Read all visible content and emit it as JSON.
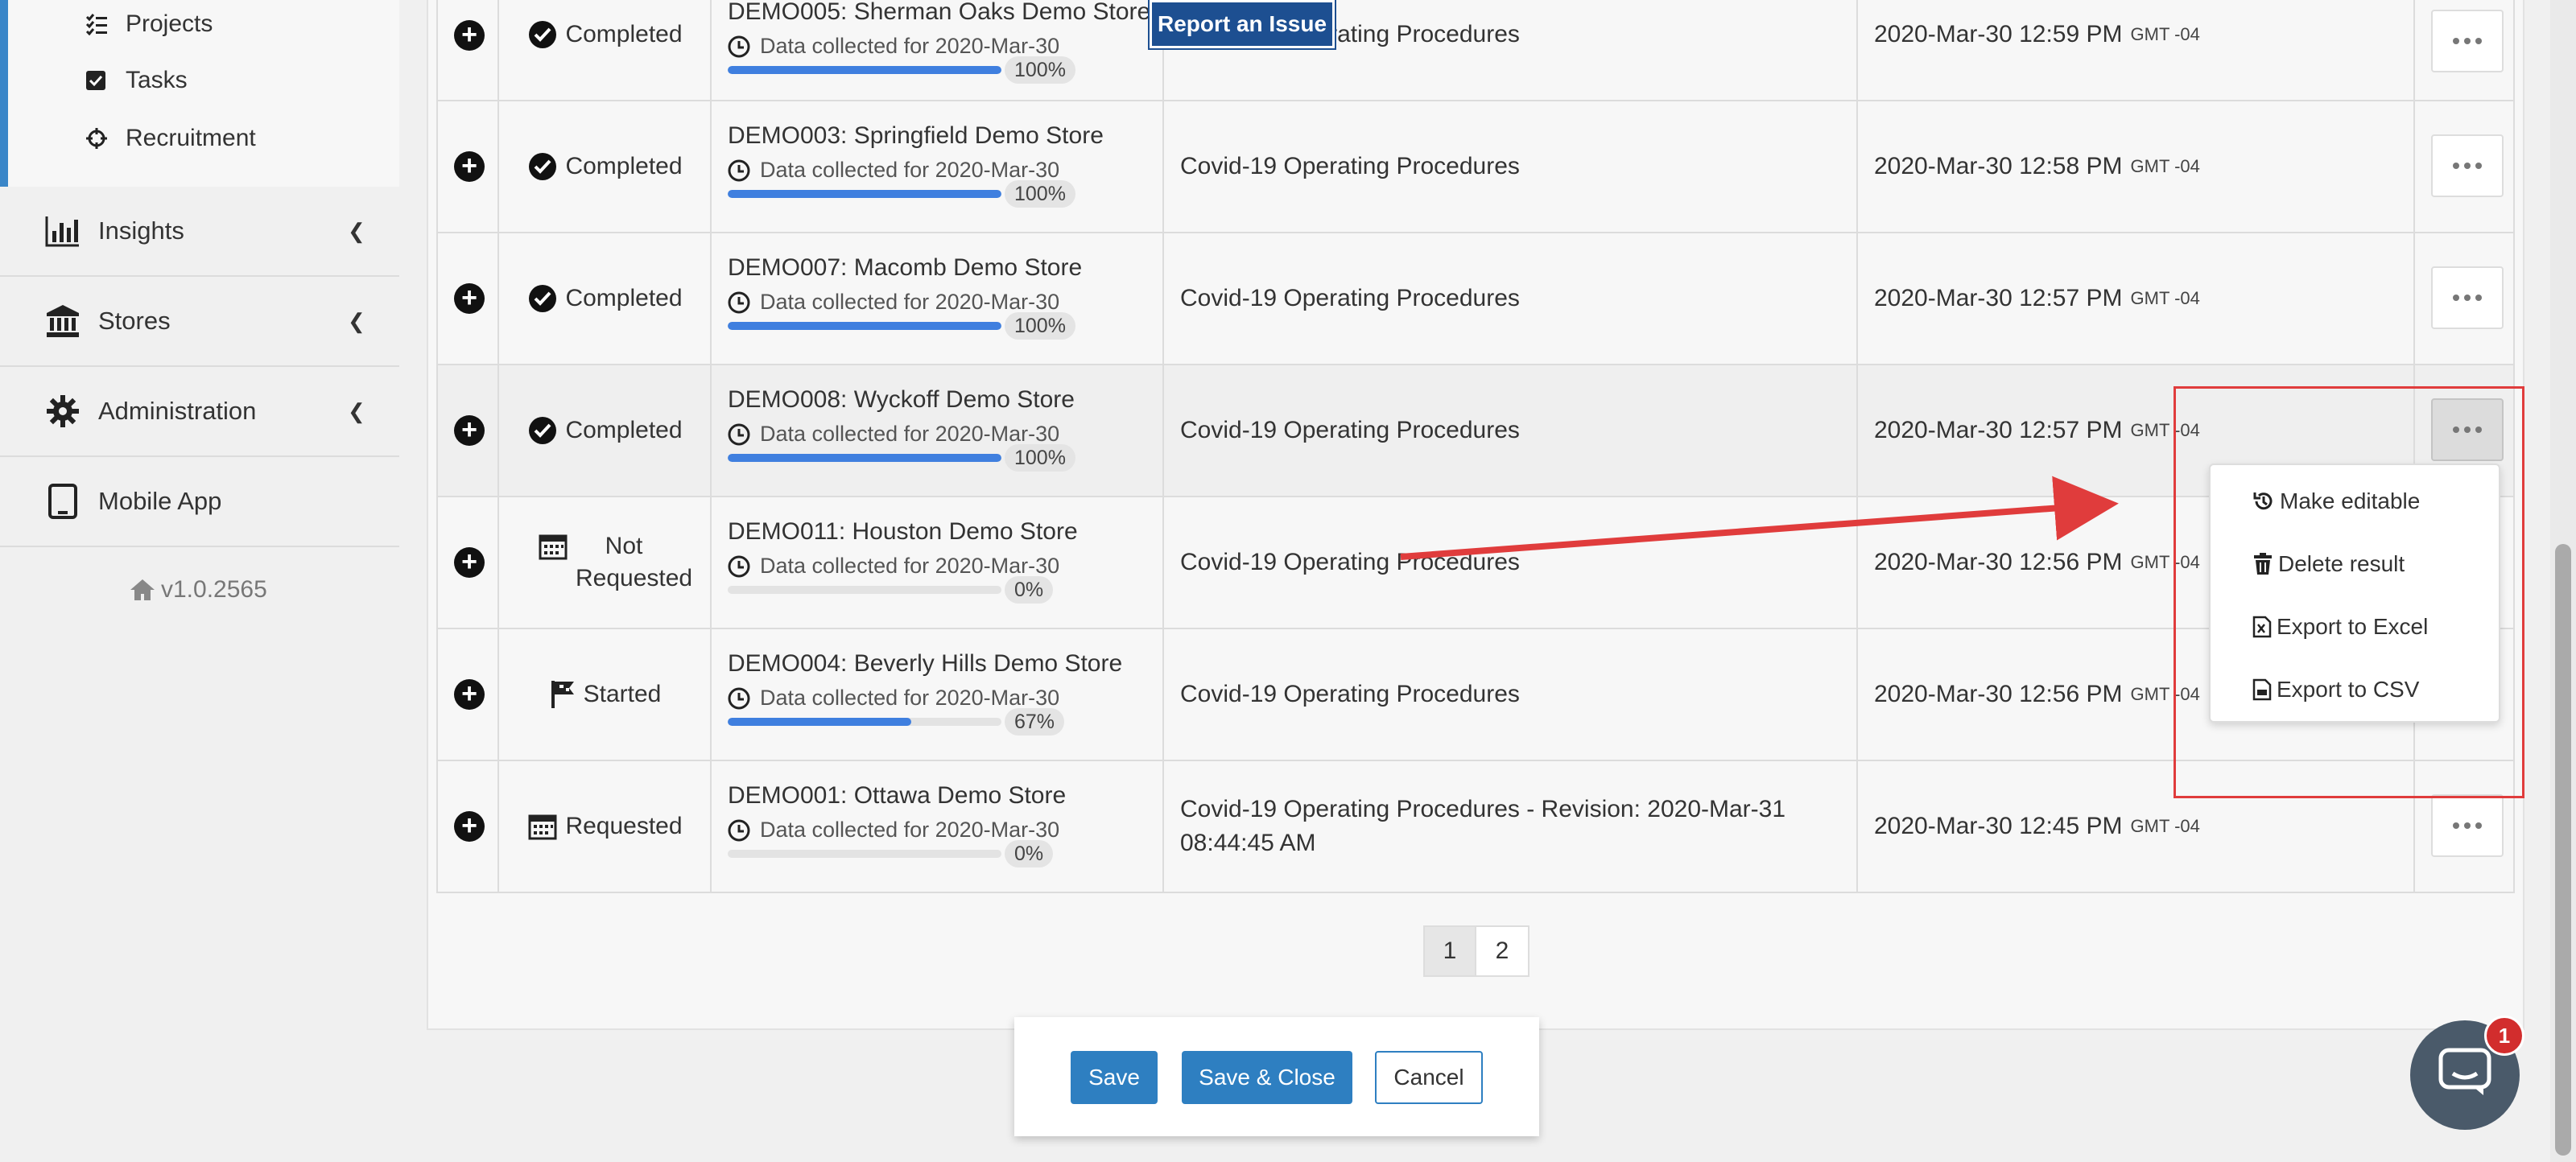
{
  "sidebar": {
    "sub_items": [
      {
        "label": "Projects",
        "icon": "list-check-icon"
      },
      {
        "label": "Tasks",
        "icon": "checkbox-icon"
      },
      {
        "label": "Recruitment",
        "icon": "crosshair-icon"
      }
    ],
    "nav_items": [
      {
        "label": "Insights",
        "icon": "bar-chart-icon"
      },
      {
        "label": "Stores",
        "icon": "bank-icon"
      },
      {
        "label": "Administration",
        "icon": "gear-icon"
      },
      {
        "label": "Mobile App",
        "icon": "tablet-icon"
      }
    ],
    "version": "v1.0.2565"
  },
  "report_issue_label": "Report an Issue",
  "rows": [
    {
      "status": "Completed",
      "store": "DEMO005: Sherman Oaks Demo Store",
      "collected": "Data collected for 2020-Mar-30",
      "progress": 100,
      "progress_label": "100%",
      "procedure": "Covid-19 Operating Procedures",
      "date": "2020-Mar-30 12:59 PM",
      "tz": "GMT -04"
    },
    {
      "status": "Completed",
      "store": "DEMO003: Springfield Demo Store",
      "collected": "Data collected for 2020-Mar-30",
      "progress": 100,
      "progress_label": "100%",
      "procedure": "Covid-19 Operating Procedures",
      "date": "2020-Mar-30 12:58 PM",
      "tz": "GMT -04"
    },
    {
      "status": "Completed",
      "store": "DEMO007: Macomb Demo Store",
      "collected": "Data collected for 2020-Mar-30",
      "progress": 100,
      "progress_label": "100%",
      "procedure": "Covid-19 Operating Procedures",
      "date": "2020-Mar-30 12:57 PM",
      "tz": "GMT -04"
    },
    {
      "status": "Completed",
      "store": "DEMO008: Wyckoff Demo Store",
      "collected": "Data collected for 2020-Mar-30",
      "progress": 100,
      "progress_label": "100%",
      "procedure": "Covid-19 Operating Procedures",
      "date": "2020-Mar-30 12:57 PM",
      "tz": "GMT -04"
    },
    {
      "status": "Not Requested",
      "store": "DEMO011: Houston Demo Store",
      "collected": "Data collected for 2020-Mar-30",
      "progress": 0,
      "progress_label": "0%",
      "procedure": "Covid-19 Operating Procedures",
      "date": "2020-Mar-30 12:56 PM",
      "tz": "GMT -04"
    },
    {
      "status": "Started",
      "store": "DEMO004: Beverly Hills Demo Store",
      "collected": "Data collected for 2020-Mar-30",
      "progress": 67,
      "progress_label": "67%",
      "procedure": "Covid-19 Operating Procedures",
      "date": "2020-Mar-30 12:56 PM",
      "tz": "GMT -04"
    },
    {
      "status": "Requested",
      "store": "DEMO001: Ottawa Demo Store",
      "collected": "Data collected for 2020-Mar-30",
      "progress": 0,
      "progress_label": "0%",
      "procedure": "Covid-19 Operating Procedures - Revision: 2020-Mar-31 08:44:45 AM",
      "date": "2020-Mar-30 12:45 PM",
      "tz": "GMT -04"
    }
  ],
  "dropdown": {
    "items": [
      {
        "label": "Make editable",
        "icon": "history-icon"
      },
      {
        "label": "Delete result",
        "icon": "trash-icon"
      },
      {
        "label": "Export to Excel",
        "icon": "excel-file-icon"
      },
      {
        "label": "Export to CSV",
        "icon": "csv-file-icon"
      }
    ]
  },
  "pagination": {
    "pages": [
      "1",
      "2"
    ],
    "current": "1"
  },
  "footer": {
    "save": "Save",
    "save_close": "Save & Close",
    "cancel": "Cancel"
  },
  "chat": {
    "badge": "1"
  },
  "colors": {
    "accent": "#2e7fc1",
    "progress": "#3f7fdf",
    "highlight_box": "#e03c3c",
    "report_bg": "#1d4f91"
  }
}
